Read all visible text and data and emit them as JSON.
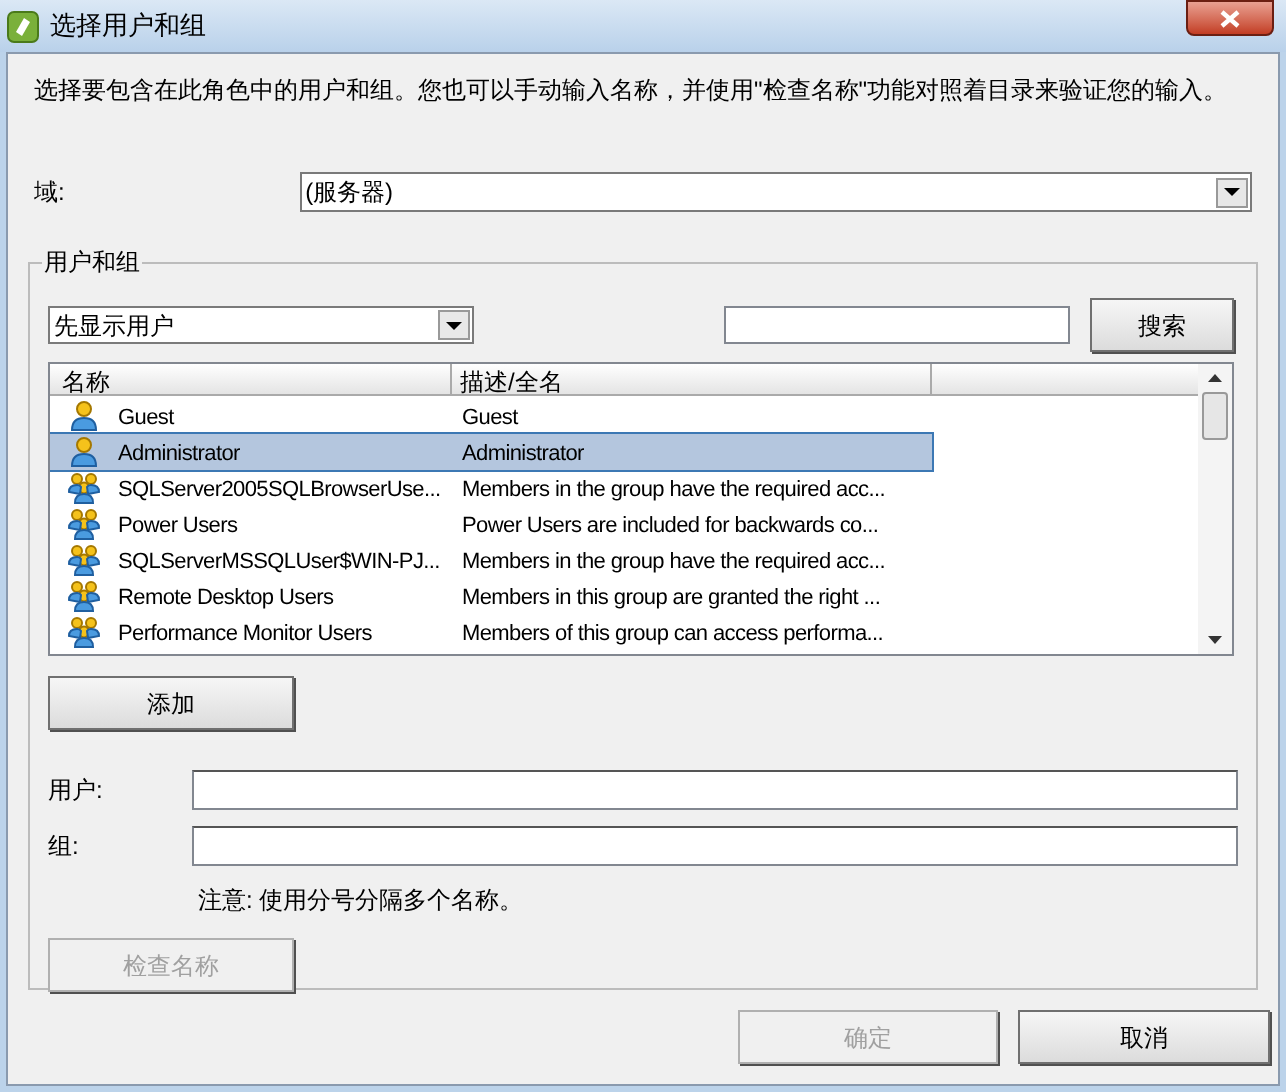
{
  "window": {
    "title": "选择用户和组"
  },
  "description": "选择要包含在此角色中的用户和组。您也可以手动输入名称，并使用\"检查名称\"功能对照着目录来验证您的输入。",
  "domain": {
    "label": "域:",
    "value": "(服务器)"
  },
  "group_box": {
    "title": "用户和组",
    "filter": {
      "value": "先显示用户"
    },
    "search_button": {
      "label": "搜索",
      "disabled": false
    },
    "table": {
      "columns": [
        "名称",
        "描述/全名"
      ],
      "rows": [
        {
          "kind": "user",
          "name": "Guest",
          "description": "Guest",
          "selected": false
        },
        {
          "kind": "user",
          "name": "Administrator",
          "description": "Administrator",
          "selected": true
        },
        {
          "kind": "group",
          "name": "SQLServer2005SQLBrowserUse...",
          "description": "Members in the group have the required acc...",
          "selected": false
        },
        {
          "kind": "group",
          "name": "Power Users",
          "description": "Power Users are included for backwards co...",
          "selected": false
        },
        {
          "kind": "group",
          "name": "SQLServerMSSQLUser$WIN-PJ...",
          "description": "Members in the group have the required acc...",
          "selected": false
        },
        {
          "kind": "group",
          "name": "Remote Desktop Users",
          "description": "Members in this group are granted the right ...",
          "selected": false
        },
        {
          "kind": "group",
          "name": "Performance Monitor Users",
          "description": "Members of this group can access performa...",
          "selected": false
        }
      ]
    },
    "add_button": {
      "label": "添加",
      "disabled": false
    },
    "fields": [
      {
        "label": "用户:"
      },
      {
        "label": "组:"
      }
    ],
    "note": "注意: 使用分号分隔多个名称。",
    "check_button": {
      "label": "检查名称",
      "disabled": true
    }
  },
  "buttons": [
    {
      "label": "确定",
      "disabled": true
    },
    {
      "label": "取消",
      "disabled": false
    }
  ]
}
